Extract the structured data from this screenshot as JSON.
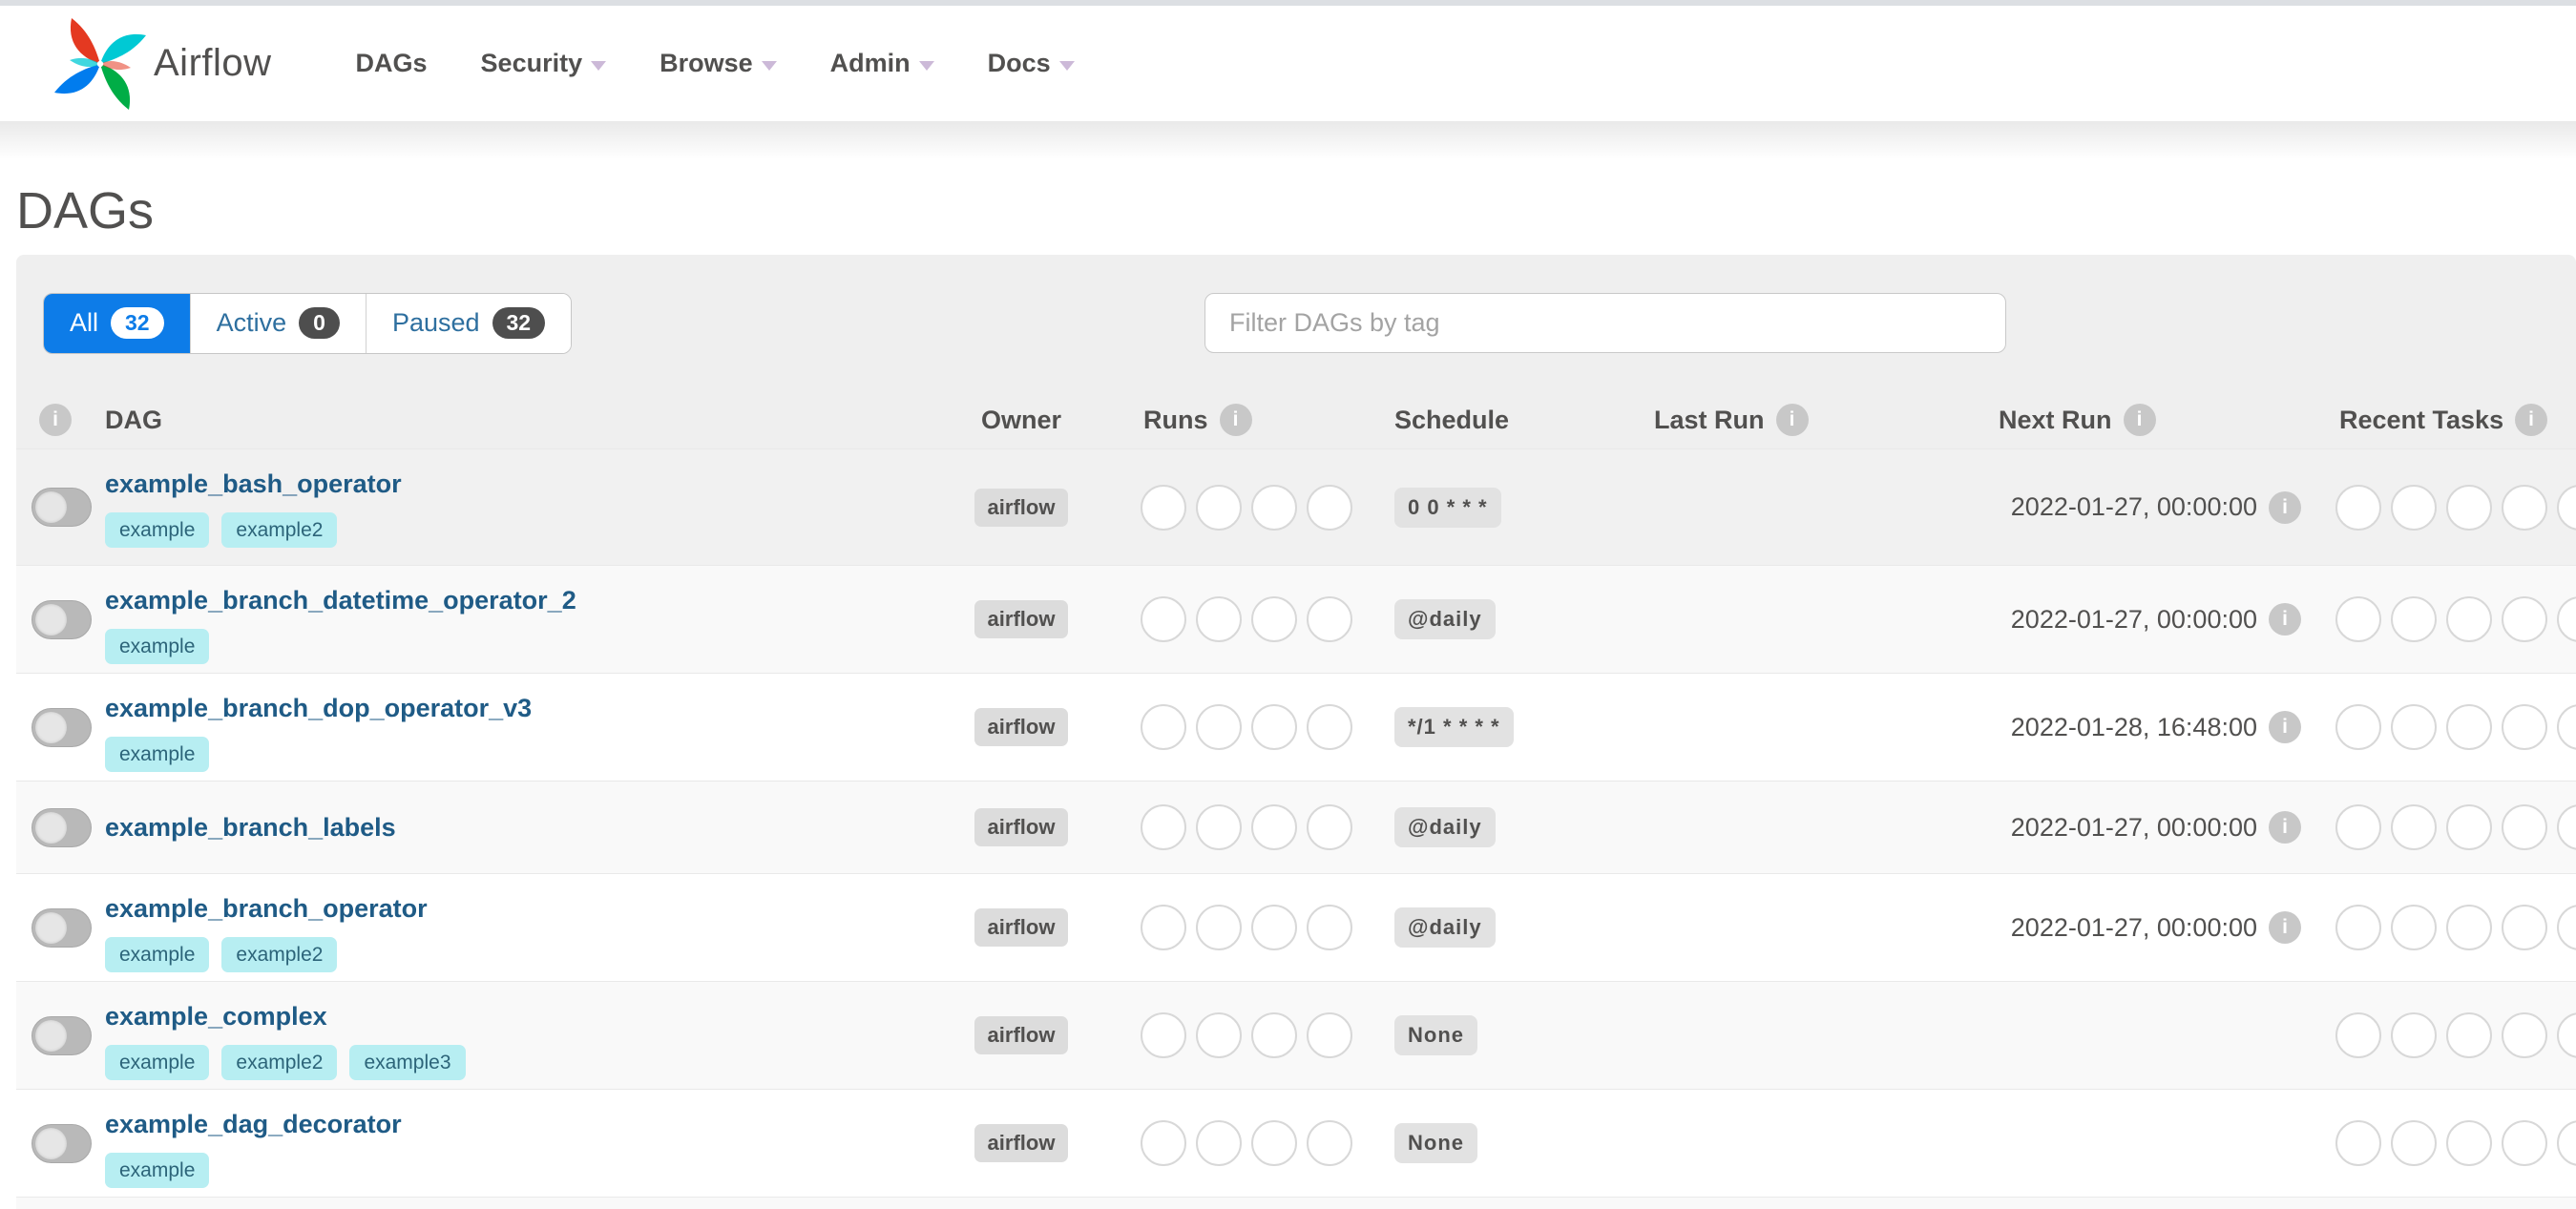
{
  "navbar": {
    "brand": "Airflow",
    "items": [
      {
        "label": "DAGs",
        "caret": false
      },
      {
        "label": "Security",
        "caret": true
      },
      {
        "label": "Browse",
        "caret": true
      },
      {
        "label": "Admin",
        "caret": true
      },
      {
        "label": "Docs",
        "caret": true
      }
    ]
  },
  "page_title": "DAGs",
  "filter_tabs": [
    {
      "label": "All",
      "count": "32",
      "active": true
    },
    {
      "label": "Active",
      "count": "0",
      "active": false
    },
    {
      "label": "Paused",
      "count": "32",
      "active": false
    }
  ],
  "search": {
    "placeholder": "Filter DAGs by tag",
    "value": ""
  },
  "table": {
    "headers": {
      "dag": "DAG",
      "owner": "Owner",
      "runs": "Runs",
      "schedule": "Schedule",
      "last_run": "Last Run",
      "next_run": "Next Run",
      "recent_tasks": "Recent Tasks"
    },
    "runs_slots": 4,
    "recent_slots": 5,
    "rows": [
      {
        "name": "example_bash_operator",
        "tags": [
          "example",
          "example2"
        ],
        "owner": "airflow",
        "schedule": "0 0 * * *",
        "last_run": "",
        "next_run": "2022-01-27, 00:00:00",
        "paused": true
      },
      {
        "name": "example_branch_datetime_operator_2",
        "tags": [
          "example"
        ],
        "owner": "airflow",
        "schedule": "@daily",
        "last_run": "",
        "next_run": "2022-01-27, 00:00:00",
        "paused": true
      },
      {
        "name": "example_branch_dop_operator_v3",
        "tags": [
          "example"
        ],
        "owner": "airflow",
        "schedule": "*/1 * * * *",
        "last_run": "",
        "next_run": "2022-01-28, 16:48:00",
        "paused": true
      },
      {
        "name": "example_branch_labels",
        "tags": [],
        "owner": "airflow",
        "schedule": "@daily",
        "last_run": "",
        "next_run": "2022-01-27, 00:00:00",
        "paused": true
      },
      {
        "name": "example_branch_operator",
        "tags": [
          "example",
          "example2"
        ],
        "owner": "airflow",
        "schedule": "@daily",
        "last_run": "",
        "next_run": "2022-01-27, 00:00:00",
        "paused": true
      },
      {
        "name": "example_complex",
        "tags": [
          "example",
          "example2",
          "example3"
        ],
        "owner": "airflow",
        "schedule": "None",
        "last_run": "",
        "next_run": "",
        "paused": true
      },
      {
        "name": "example_dag_decorator",
        "tags": [
          "example"
        ],
        "owner": "airflow",
        "schedule": "None",
        "last_run": "",
        "next_run": "",
        "paused": true
      }
    ]
  },
  "colors": {
    "accent_blue": "#0d7ce8",
    "dag_link": "#1f5b86",
    "tag_bg": "#b7eef2",
    "tag_text": "#2c6479",
    "badge_dark": "#4e4e4e",
    "body_text": "#51504f",
    "logo_red": "#e43921",
    "logo_cyan": "#00c9d4",
    "logo_green": "#00ad46",
    "logo_blue": "#017cee"
  }
}
